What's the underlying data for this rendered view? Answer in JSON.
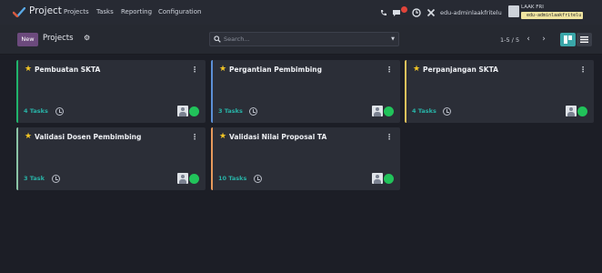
{
  "topnav": {
    "app_name": "Project",
    "menu": [
      "Projects",
      "Tasks",
      "Reporting",
      "Configuration"
    ],
    "user_name": "edu-adminlaakfritelu",
    "company_name": "LAAK FRI",
    "company_db": "edu-adminlaakfritelu",
    "icons": [
      "phone-icon",
      "chat-icon",
      "clock-icon",
      "tools-icon"
    ]
  },
  "control_panel": {
    "new_label": "New",
    "breadcrumb": "Projects",
    "search_placeholder": "Search...",
    "pager": "1-5 / 5"
  },
  "projects": [
    {
      "name": "Pembuatan SKTA",
      "tasks": "4 Tasks",
      "color": "#20b36b"
    },
    {
      "name": "Pergantian Pembimbing",
      "tasks": "3 Tasks",
      "color": "#5c8fd6"
    },
    {
      "name": "Perpanjangan SKTA",
      "tasks": "4 Tasks",
      "color": "#e3c25b"
    },
    {
      "name": "Validasi Dosen Pembimbing",
      "tasks": "3 Task",
      "color": "#8bc4a6"
    },
    {
      "name": "Validasi Nilai Proposal TA",
      "tasks": "10 Tasks",
      "color": "#e79a5c"
    }
  ],
  "colors": {
    "accent": "#6c4a7d",
    "teal": "#3aa6a9",
    "status_green": "#21c35a",
    "star": "#f3c624"
  }
}
